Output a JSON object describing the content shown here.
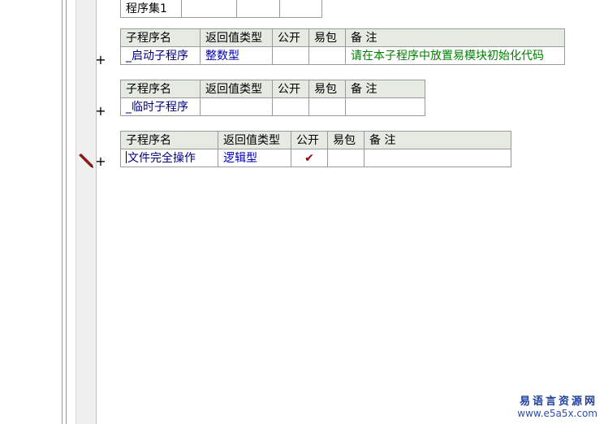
{
  "assembly_table": {
    "name": "程序集1"
  },
  "header_labels": {
    "sub_name": "子程序名",
    "return_type": "返回值类型",
    "public": "公开",
    "easy_pack": "易包",
    "remark": "备 注"
  },
  "subroutines": [
    {
      "name": "_启动子程序",
      "return_type": "整数型",
      "public": "",
      "easy_pack": "",
      "remark": "请在本子程序中放置易模块初始化代码"
    },
    {
      "name": "_临时子程序",
      "return_type": "",
      "public": "",
      "easy_pack": "",
      "remark": ""
    },
    {
      "name": "文件完全操作",
      "return_type": "逻辑型",
      "public": "✔",
      "easy_pack": "",
      "remark": ""
    }
  ],
  "expander_symbol": "+",
  "watermark": {
    "line1": "易语言资源网",
    "line2": "www.e5a5x.com"
  },
  "colors": {
    "header_bg": "#e5ebe2",
    "name_text": "#000080",
    "remark_text": "#008000",
    "check": "#a00000"
  }
}
